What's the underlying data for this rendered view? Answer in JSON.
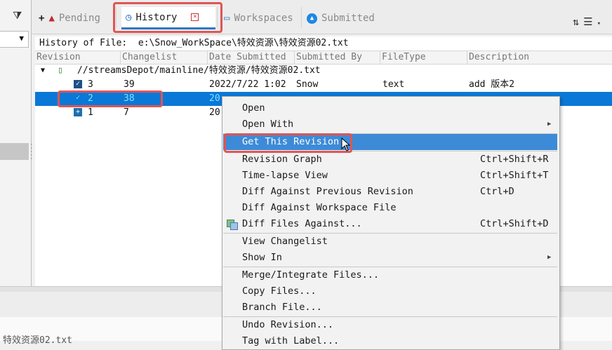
{
  "tabs": [
    {
      "label": "Pending",
      "icon": "pending-triangle-icon"
    },
    {
      "label": "History",
      "icon": "clock-icon",
      "active": true
    },
    {
      "label": "Workspaces",
      "icon": "monitor-icon"
    },
    {
      "label": "Submitted",
      "icon": "submitted-triangle-icon"
    }
  ],
  "history": {
    "path_label": "History of File:",
    "path_value": "e:\\Snow_WorkSpace\\特效资源\\特效资源02.txt",
    "columns": [
      "Revision",
      "Changelist",
      "Date Submitted",
      "Submitted By",
      "FileType",
      "Description"
    ],
    "tree_root": "//streamsDepot/mainline/特效资源/特效资源02.txt",
    "rows": [
      {
        "revision": "3",
        "changelist": "39",
        "date": "2022/7/22 1:02",
        "user": "Snow",
        "filetype": "text",
        "description": "add 版本2"
      },
      {
        "revision": "2",
        "changelist": "38",
        "date": "20",
        "user": "",
        "filetype": "",
        "description": ""
      },
      {
        "revision": "1",
        "changelist": "7",
        "date": "20",
        "user": "",
        "filetype": "",
        "description": ""
      }
    ]
  },
  "context_menu": {
    "open": "Open",
    "open_with": "Open With",
    "get_this_revision": "Get This Revision",
    "revision_graph": "Revision Graph",
    "revision_graph_sc": "Ctrl+Shift+R",
    "time_lapse": "Time-lapse View",
    "time_lapse_sc": "Ctrl+Shift+T",
    "diff_prev": "Diff Against Previous Revision",
    "diff_prev_sc": "Ctrl+D",
    "diff_ws": "Diff Against Workspace File",
    "diff_files": "Diff Files Against...",
    "diff_files_sc": "Ctrl+Shift+D",
    "view_changelist": "View Changelist",
    "show_in": "Show In",
    "merge": "Merge/Integrate Files...",
    "copy": "Copy Files...",
    "branch": "Branch File...",
    "undo": "Undo Revision...",
    "tag": "Tag with Label..."
  },
  "status": {
    "text": "特效资源02.txt"
  },
  "colors": {
    "accent": "#0a78d7",
    "highlight_box": "#e05555",
    "menu_hover": "#3d8bd7"
  }
}
